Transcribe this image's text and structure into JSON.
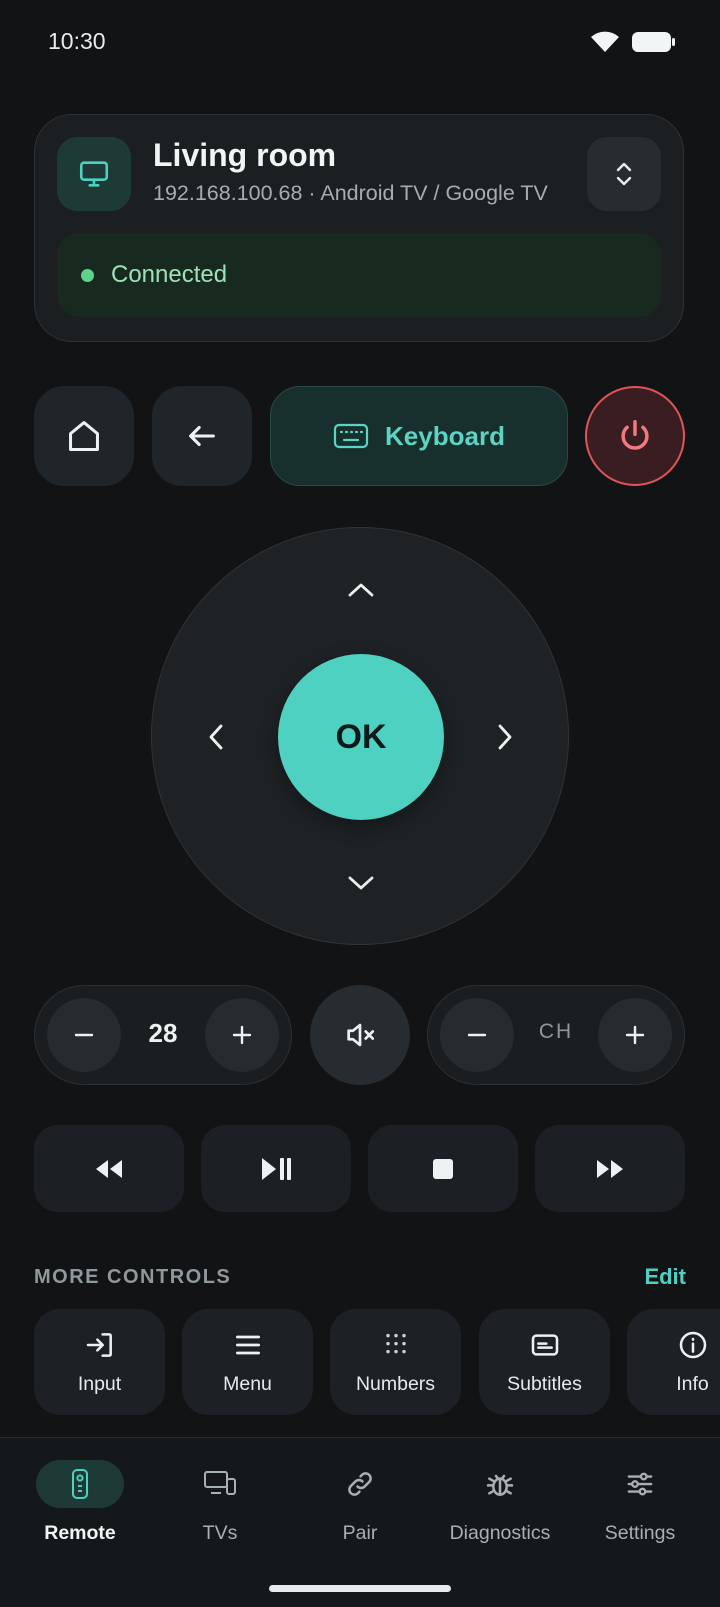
{
  "status_bar": {
    "time": "10:30"
  },
  "device": {
    "name": "Living room",
    "address": "192.168.100.68 · Android TV / Google TV",
    "status": "Connected"
  },
  "controls": {
    "keyboard_label": "Keyboard",
    "ok_label": "OK",
    "volume": "28",
    "channel_label": "CH"
  },
  "more_controls": {
    "title": "MORE CONTROLS",
    "edit_label": "Edit",
    "items": [
      {
        "label": "Input",
        "icon": "input-icon"
      },
      {
        "label": "Menu",
        "icon": "menu-icon"
      },
      {
        "label": "Numbers",
        "icon": "numbers-icon"
      },
      {
        "label": "Subtitles",
        "icon": "subtitles-icon"
      },
      {
        "label": "Info",
        "icon": "info-icon"
      }
    ]
  },
  "nav": {
    "items": [
      {
        "label": "Remote",
        "icon": "remote-icon",
        "active": true
      },
      {
        "label": "TVs",
        "icon": "tvs-icon"
      },
      {
        "label": "Pair",
        "icon": "link-icon"
      },
      {
        "label": "Diagnostics",
        "icon": "bug-icon"
      },
      {
        "label": "Settings",
        "icon": "sliders-icon"
      }
    ]
  },
  "colors": {
    "accent": "#4FD1C2",
    "background": "#111315",
    "connected": "#5FD28C",
    "power": "#E0555B"
  }
}
